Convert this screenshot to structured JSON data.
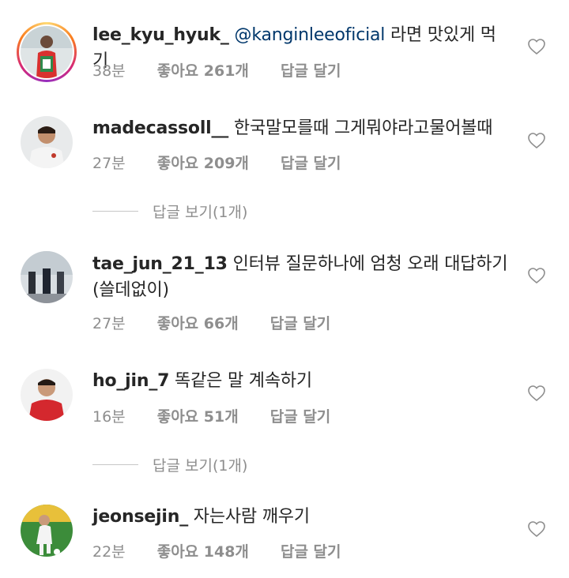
{
  "comments": [
    {
      "username": "lee_kyu_hyuk_",
      "mention": "@kanginleeoficial",
      "text": " 라면 맛있게 먹기",
      "time": "38분",
      "likes": "좋아요 261개",
      "reply": "답글 달기",
      "has_story": true
    },
    {
      "username": "madecassoll__",
      "text": " 한국말모를때 그게뭐야라고물어볼때",
      "time": "27분",
      "likes": "좋아요 209개",
      "reply": "답글 달기",
      "view_replies": "답글 보기(1개)"
    },
    {
      "username": "tae_jun_21_13",
      "text": " 인터뷰 질문하나에 엄청 오래 대답하기 (쓸데없이)",
      "time": "27분",
      "likes": "좋아요 66개",
      "reply": "답글 달기"
    },
    {
      "username": "ho_jin_7",
      "text": " 똑같은 말 계속하기",
      "time": "16분",
      "likes": "좋아요 51개",
      "reply": "답글 달기",
      "view_replies": "답글 보기(1개)"
    },
    {
      "username": "jeonsejin_",
      "text": " 자는사람 깨우기",
      "time": "22분",
      "likes": "좋아요 148개",
      "reply": "답글 달기"
    }
  ]
}
